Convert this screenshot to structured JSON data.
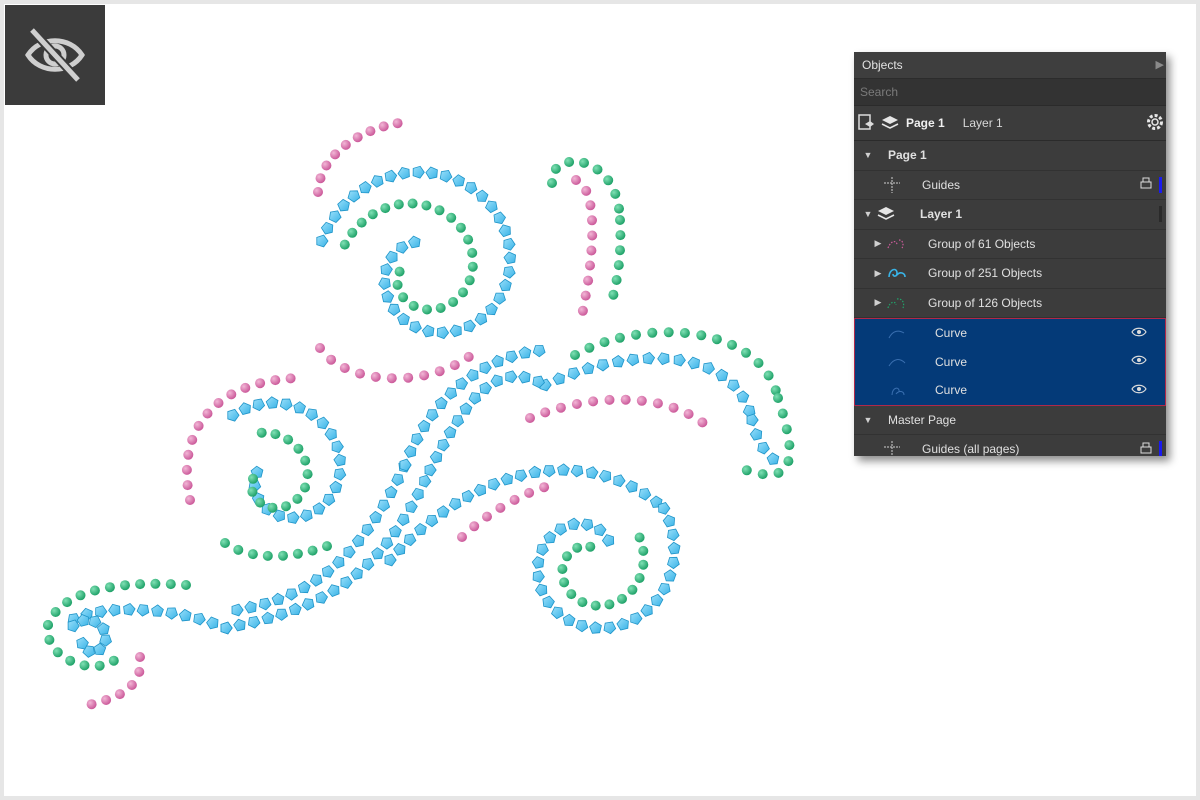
{
  "badge": {
    "icon": "hidden-eye-icon"
  },
  "artwork": {
    "colors": {
      "pink": "#cc5b9b",
      "green": "#21a36a",
      "blue": "#39b3e6"
    }
  },
  "objects_panel": {
    "title": "Objects",
    "search_placeholder": "Search",
    "toolbar": {
      "page_label": "Page 1",
      "layer_label": "Layer 1"
    },
    "tree": {
      "page": "Page 1",
      "guides": "Guides",
      "layer": "Layer 1",
      "groups": [
        "Group of 61 Objects",
        "Group of 251 Objects",
        "Group of 126 Objects"
      ],
      "curves": [
        "Curve",
        "Curve",
        "Curve"
      ],
      "master_page": "Master Page",
      "master_guides": "Guides (all pages)"
    },
    "colors": {
      "selection": "#043a78",
      "selection_border": "#b0284a",
      "panel": "#3c3c3c"
    }
  }
}
